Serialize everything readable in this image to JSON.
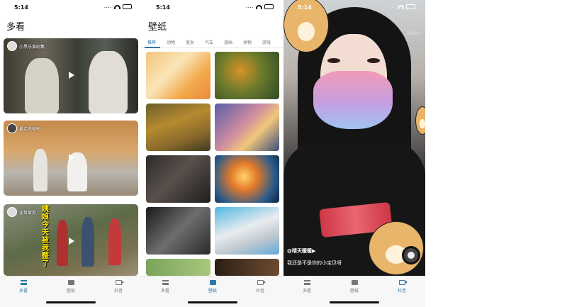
{
  "status_bar": {
    "time": "5:14",
    "signal": "...."
  },
  "tabs": [
    "多看",
    "壁纸",
    "抖音"
  ],
  "screen1": {
    "title": "多看",
    "videos": [
      {
        "uploader": "小黑乐事剧集"
      },
      {
        "uploader": "暴走说电影"
      },
      {
        "uploader": "龙哥爱剪",
        "banner": "姨娘今天被我整了"
      }
    ],
    "active_tab": 0
  },
  "screen2": {
    "title": "壁纸",
    "categories": [
      "推荐",
      "动物",
      "美女",
      "汽车",
      "漫画",
      "食物",
      "游戏"
    ],
    "active_category": 0,
    "active_tab": 1
  },
  "screen3": {
    "username": "@晴天暖暖▶",
    "caption": "我还是不是你的小宝贝呀",
    "watermark": "Sten",
    "active_tab": 2
  },
  "colors": {
    "accent": "#2a78a8",
    "inactive": "#777777"
  }
}
